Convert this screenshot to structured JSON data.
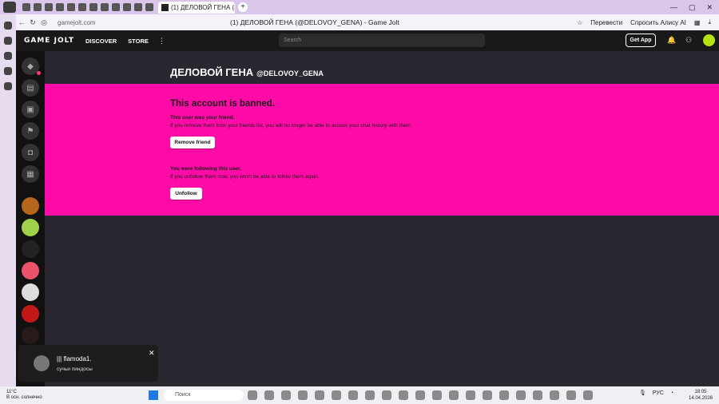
{
  "browser": {
    "tab_title": "(1) ДЕЛОВОЙ ГЕНА (@",
    "url": "gamejolt.com",
    "page_title": "(1) ДЕЛОВОЙ ГЕНА (@DELOVOY_GENA) - Game Jolt",
    "translate_label": "Перевести",
    "alisa_label": "Спросить Алису AI"
  },
  "header": {
    "logo": "GAME JOLT",
    "nav": [
      "DISCOVER",
      "STORE"
    ],
    "search_placeholder": "Search",
    "get_app_label": "Get App"
  },
  "profile": {
    "name": "ДЕЛОВОЙ ГЕНА",
    "handle": "@DELOVOY_GENA"
  },
  "banned": {
    "title": "This account is banned.",
    "friend_heading": "This user was your friend.",
    "friend_text": "If you remove them from your friends list, you will no longer be able to access your chat history with them.",
    "remove_friend_label": "Remove friend",
    "following_heading": "You were following this user.",
    "following_text": "If you unfollow them now, you won't be able to follow them again.",
    "unfollow_label": "Unfollow",
    "background_color": "#ff0ca8"
  },
  "toast": {
    "name": "||| flamoda1.",
    "message": "сучьи пиндосы"
  },
  "taskbar": {
    "weather_temp": "11°C",
    "weather_desc": "В осн. солнечно",
    "search_label": "Поиск",
    "lang": "РУС",
    "time": "18:05",
    "date": "14.04.2026"
  }
}
